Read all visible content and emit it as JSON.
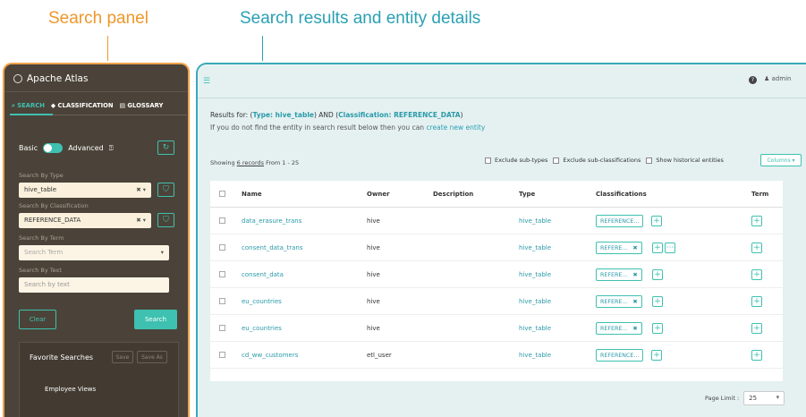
{
  "callouts": {
    "left": "Search panel",
    "right": "Search results and entity details"
  },
  "panel": {
    "title": "Apache Atlas",
    "tabs": [
      "SEARCH",
      "CLASSIFICATION",
      "GLOSSARY"
    ],
    "mode_basic": "Basic",
    "mode_advanced": "Advanced",
    "search_by_type_label": "Search By Type",
    "search_by_type_value": "hive_table",
    "search_by_classification_label": "Search By Classification",
    "search_by_classification_value": "REFERENCE_DATA",
    "search_by_term_label": "Search By Term",
    "search_by_term_placeholder": "Search Term",
    "search_by_text_label": "Search By Text",
    "search_by_text_placeholder": "Search by text",
    "clear_label": "Clear",
    "search_label": "Search",
    "favorites_title": "Favorite Searches",
    "favorites_save": "Save",
    "favorites_save_as": "Save As",
    "favorite_items": [
      "Employee Views"
    ]
  },
  "main": {
    "user": "admin",
    "results_prefix": "Results for: (",
    "results_type": "Type: hive_table",
    "results_mid": ") AND (",
    "results_class": "Classification: REFERENCE_DATA",
    "results_suffix": ")",
    "notfound_text": "If you do not find the entity in search result below then you can",
    "notfound_link": "create new entity",
    "showing_prefix": "Showing",
    "showing_count": "6 records",
    "showing_suffix": "From 1 - 25",
    "exclude_subtypes": "Exclude sub-types",
    "exclude_subclass": "Exclude sub-classifications",
    "show_historical": "Show historical entities",
    "columns_label": "Columns",
    "headers": {
      "name": "Name",
      "owner": "Owner",
      "description": "Description",
      "type": "Type",
      "classifications": "Classifications",
      "term": "Term"
    },
    "rows": [
      {
        "name": "data_erasure_trans",
        "owner": "hive",
        "type": "hive_table",
        "cls": "REFERENCE..."
      },
      {
        "name": "consent_data_trans",
        "owner": "hive",
        "type": "hive_table",
        "cls": "REFERE..."
      },
      {
        "name": "consent_data",
        "owner": "hive",
        "type": "hive_table",
        "cls": "REFERE..."
      },
      {
        "name": "eu_countries",
        "owner": "hive",
        "type": "hive_table",
        "cls": "REFERE..."
      },
      {
        "name": "eu_countries",
        "owner": "hive",
        "type": "hive_table",
        "cls": "REFERE..."
      },
      {
        "name": "cd_ww_customers",
        "owner": "etl_user",
        "type": "hive_table",
        "cls": "REFERENCE..."
      }
    ],
    "page_limit_label": "Page Limit :",
    "page_limit_value": "25"
  }
}
